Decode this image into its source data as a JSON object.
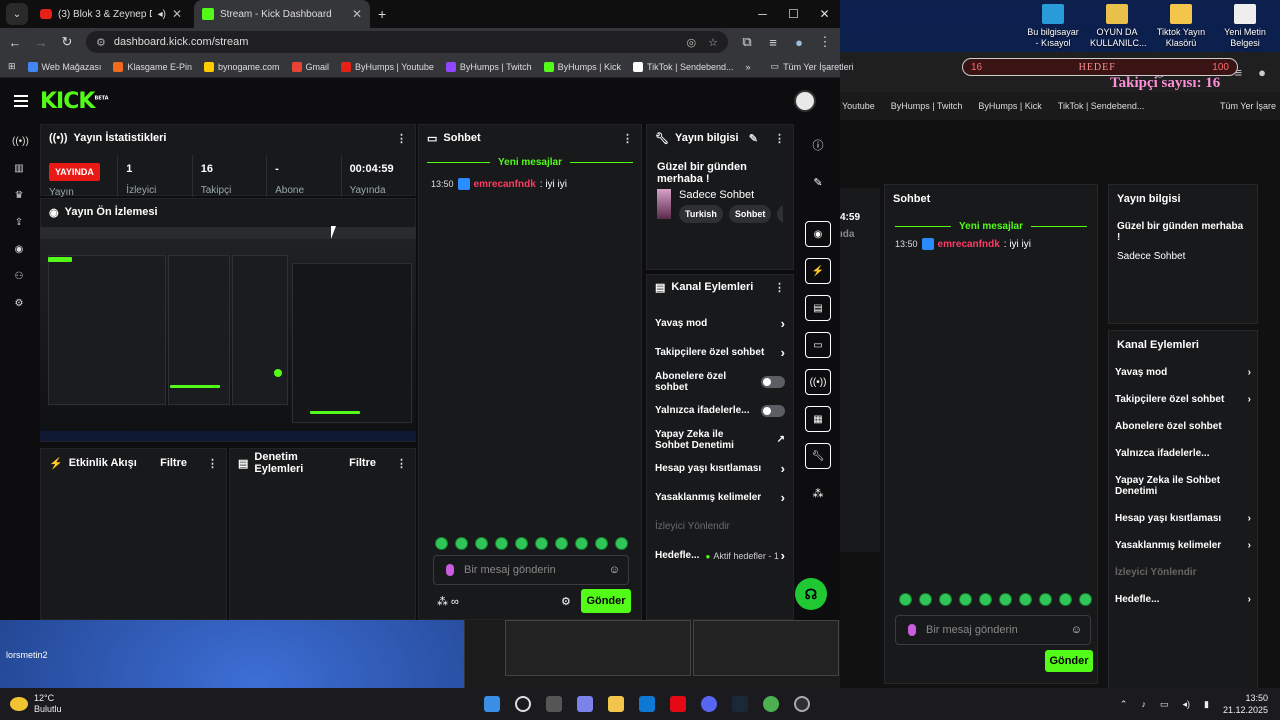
{
  "desktop": {
    "icons": [
      {
        "label": "Bu bilgisayar - Kısayol",
        "color": "#2a9bd9"
      },
      {
        "label": "OYUN DA KULLANILC...",
        "color": "#e8c04a"
      },
      {
        "label": "Tiktok Yayın Klasörü",
        "color": "#f4c54b"
      },
      {
        "label": "Yeni Metin Belgesi",
        "color": "#eeeeee"
      }
    ],
    "goal_left": "16",
    "goal_label": "HEDEF",
    "goal_right": "100",
    "follower_text": "Takipçi sayısı: 16",
    "user_label": "lorsmetin2"
  },
  "browser": {
    "tabs": [
      {
        "title": "(3) Blok 3 & Zeynep Dizdar",
        "favicon": "youtube"
      },
      {
        "title": "Stream - Kick Dashboard",
        "favicon": "kick"
      }
    ],
    "new_tab": "+",
    "url": "dashboard.kick.com/stream",
    "bookmarks": [
      {
        "label": "Web Mağazası",
        "color": "#4285f4"
      },
      {
        "label": "Klasgame E-Pin",
        "color": "#f26a1b"
      },
      {
        "label": "bynogame.com",
        "color": "#ffcc00"
      },
      {
        "label": "Gmail",
        "color": "#ea4335"
      },
      {
        "label": "ByHumps | Youtube",
        "color": "#e62117"
      },
      {
        "label": "ByHumps | Twitch",
        "color": "#9146ff"
      },
      {
        "label": "ByHumps | Kick",
        "color": "#53fc18"
      },
      {
        "label": "TikTok | Sendebend...",
        "color": "#ffffff"
      }
    ],
    "bookmarks_more": "»",
    "all_bookmarks": "Tüm Yer İşaretleri"
  },
  "mirror": {
    "bookmarks": [
      "Youtube",
      "ByHumps | Twitch",
      "ByHumps | Kick",
      "TikTok | Sendebend..."
    ],
    "all_bookmarks": "Tüm Yer İşare",
    "stat_time": "4:59",
    "stat_sub": "ıda"
  },
  "app": {
    "logo": "KICK",
    "logo_beta": "BETA",
    "stats": {
      "title": "Yayın İstatistikleri",
      "live": "YAYINDA",
      "live_sub": "Yayın",
      "items": [
        {
          "value": "1",
          "label": "İzleyici"
        },
        {
          "value": "16",
          "label": "Takipçi"
        },
        {
          "value": "-",
          "label": "Abone"
        },
        {
          "value": "00:04:59",
          "label": "Yayında"
        }
      ]
    },
    "preview": {
      "title": "Yayın Ön İzlemesi"
    },
    "activity": {
      "title": "Etkinlik Akışı",
      "filter": "Filtre"
    },
    "moderation": {
      "title": "Denetim Eylemleri",
      "filter": "Filtre"
    },
    "chat": {
      "title": "Sohbet",
      "new_messages": "Yeni mesajlar",
      "messages": [
        {
          "time": "13:50",
          "user": "emrecanfndk",
          "text": ": iyi iyi"
        }
      ],
      "placeholder": "Bir mesaj gönderin",
      "send": "Gönder"
    },
    "stream_info": {
      "title": "Yayın bilgisi",
      "stream_title": "Güzel bir günden merhaba !",
      "category": "Sadece Sohbet",
      "tags": [
        "Turkish",
        "Sohbet",
        "Tı"
      ]
    },
    "channel_actions": {
      "title": "Kanal Eylemleri",
      "rows": [
        {
          "label": "Yavaş mod",
          "control": "chevron"
        },
        {
          "label": "Takipçilere özel sohbet",
          "control": "chevron"
        },
        {
          "label": "Abonelere özel sohbet",
          "control": "toggle"
        },
        {
          "label": "Yalnızca ifadelerle...",
          "control": "toggle"
        },
        {
          "label": "Yapay Zeka ile Sohbet Denetimi",
          "control": "external"
        },
        {
          "label": "Hesap yaşı kısıtlaması",
          "control": "chevron"
        },
        {
          "label": "Yasaklanmış kelimeler",
          "control": "chevron"
        },
        {
          "label": "İzleyici Yönlendir",
          "control": "none"
        },
        {
          "label": "Hedefle...",
          "control": "goal",
          "extra": "Aktif hedefler - 1"
        }
      ]
    }
  },
  "taskbar": {
    "temperature": "12°C",
    "condition": "Bulutlu",
    "time": "13:50",
    "date": "21.12.2025"
  }
}
